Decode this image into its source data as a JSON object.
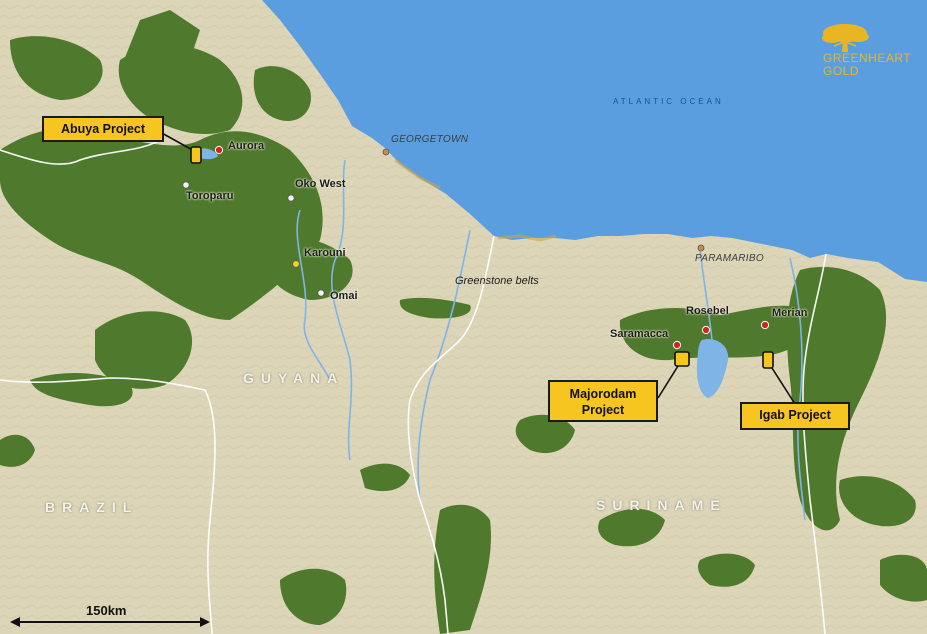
{
  "logo": {
    "line1": "GREENHEART",
    "line2": "GOLD",
    "icon": "tree-icon",
    "color": "#e8b625"
  },
  "ocean_label": "ATLANTIC OCEAN",
  "countries": {
    "guyana": "GUYANA",
    "brazil": "BRAZIL",
    "suriname": "SURINAME"
  },
  "cities": {
    "georgetown": "GEORGETOWN",
    "paramaribo": "PARAMARIBO"
  },
  "feature_label": "Greenstone belts",
  "projects": {
    "abuya": "Abuya Project",
    "majorodam_line1": "Majorodam",
    "majorodam_line2": "Project",
    "igab": "Igab Project"
  },
  "sites": {
    "aurora": "Aurora",
    "toroparu": "Toroparu",
    "oko_west": "Oko West",
    "karouni": "Karouni",
    "omai": "Omai",
    "rosebel": "Rosebel",
    "saramacca": "Saramacca",
    "merian": "Merian"
  },
  "scale_bar": {
    "label": "150km"
  },
  "colors": {
    "ocean": "#5b9ee0",
    "land": "#dcd5b8",
    "greenstone": "#4f7a2d",
    "callout": "#f7c520",
    "producing_mine": "#d42020",
    "project_site": "#f2f2f2",
    "karouni_marker": "#f5d21a"
  }
}
